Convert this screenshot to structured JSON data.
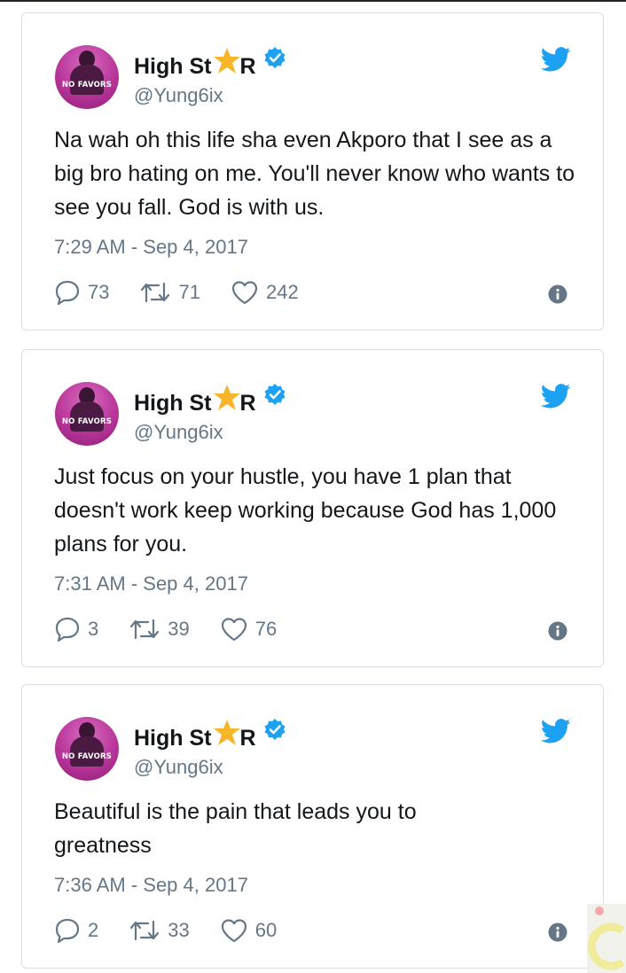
{
  "tweets": [
    {
      "avatar_text": "NO FAVORS",
      "display_name_prefix": "High St",
      "display_name_suffix": "R",
      "handle": "@Yung6ix",
      "text": "Na wah oh this life sha even Akporo that I see as a big bro hating on me. You'll never know who wants to see you fall. God is with us.",
      "timestamp": "7:29 AM - Sep 4, 2017",
      "replies": "73",
      "retweets": "71",
      "likes": "242"
    },
    {
      "avatar_text": "NO FAVORS",
      "display_name_prefix": "High St",
      "display_name_suffix": "R",
      "handle": "@Yung6ix",
      "text": "Just focus on your hustle, you have 1 plan that doesn't work keep working because God has 1,000 plans for you.",
      "timestamp": "7:31 AM - Sep 4, 2017",
      "replies": "3",
      "retweets": "39",
      "likes": "76"
    },
    {
      "avatar_text": "NO FAVORS",
      "display_name_prefix": "High St",
      "display_name_suffix": "R",
      "handle": "@Yung6ix",
      "text": "Beautiful is the pain that leads you to greatness",
      "timestamp": "7:36 AM - Sep 4, 2017",
      "replies": "2",
      "retweets": "33",
      "likes": "60"
    }
  ],
  "icons": {
    "star": "star-emoji-icon",
    "verified": "verified-badge-icon",
    "bird": "twitter-bird-icon",
    "reply": "reply-icon",
    "retweet": "retweet-icon",
    "like": "heart-icon",
    "info": "info-icon"
  },
  "colors": {
    "twitter_blue": "#1da1f2",
    "star_yellow": "#f7b52a",
    "avatar_magenta": "#b8359a",
    "text_gray": "#657786",
    "card_border": "#d8dfe5"
  }
}
